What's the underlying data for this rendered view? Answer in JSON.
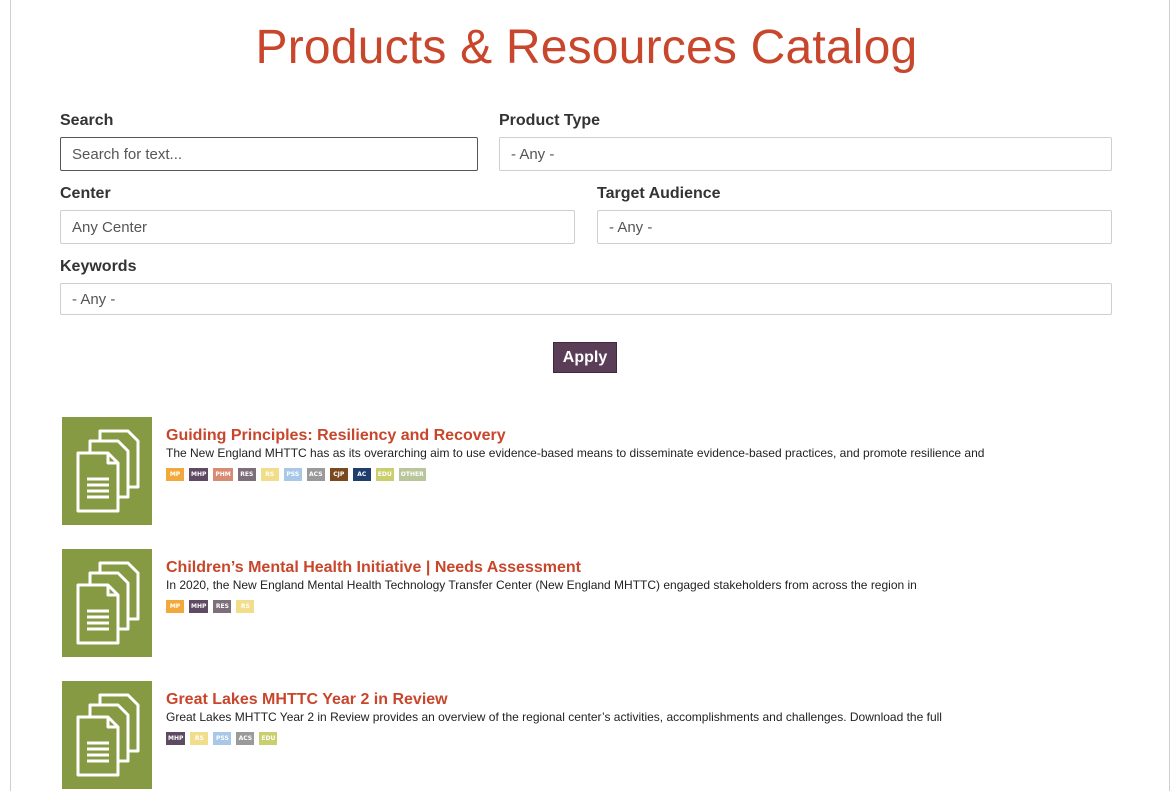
{
  "page": {
    "title": "Products & Resources Catalog"
  },
  "filters": {
    "search_label": "Search",
    "search_placeholder": "Search for text...",
    "product_type_label": "Product Type",
    "product_type_value": "- Any -",
    "center_label": "Center",
    "center_value": "Any Center",
    "target_audience_label": "Target Audience",
    "target_audience_value": "- Any -",
    "keywords_label": "Keywords",
    "keywords_value": "- Any -",
    "apply_label": "Apply"
  },
  "results": [
    {
      "title": "Guiding Principles: Resiliency and Recovery",
      "description": "The New England MHTTC has as its overarching aim to use evidence-based means to disseminate evidence-based practices, and promote resilience and",
      "icon": "document-stack-icon",
      "tags": [
        {
          "label": "MP",
          "color": "#f2a93b"
        },
        {
          "label": "MHP",
          "color": "#5e4a63"
        },
        {
          "label": "PHM",
          "color": "#d98a72"
        },
        {
          "label": "RES",
          "color": "#7d6e7c"
        },
        {
          "label": "RS",
          "color": "#f1dd8a"
        },
        {
          "label": "PSS",
          "color": "#a9c8e8"
        },
        {
          "label": "ACS",
          "color": "#9a9a9a"
        },
        {
          "label": "CJP",
          "color": "#7a4a1e"
        },
        {
          "label": "AC",
          "color": "#1f3e6d"
        },
        {
          "label": "EDU",
          "color": "#c9cf6d"
        },
        {
          "label": "OTHER",
          "color": "#b9c59a"
        }
      ]
    },
    {
      "title": "Children’s Mental Health Initiative | Needs Assessment",
      "description": "In 2020, the New England Mental Health Technology Transfer Center (New England MHTTC) engaged stakeholders from across the region in",
      "icon": "document-stack-icon",
      "tags": [
        {
          "label": "MP",
          "color": "#f2a93b"
        },
        {
          "label": "MHP",
          "color": "#5e4a63"
        },
        {
          "label": "RES",
          "color": "#7d6e7c"
        },
        {
          "label": "RS",
          "color": "#f1dd8a"
        }
      ]
    },
    {
      "title": "Great Lakes MHTTC Year 2 in Review",
      "description": "Great Lakes MHTTC Year 2 in Review provides an overview of the regional center’s activities, accomplishments and challenges. Download the full",
      "icon": "document-stack-icon",
      "tags": [
        {
          "label": "MHP",
          "color": "#5e4a63"
        },
        {
          "label": "RS",
          "color": "#f1dd8a"
        },
        {
          "label": "PSS",
          "color": "#a9c8e8"
        },
        {
          "label": "ACS",
          "color": "#9a9a9a"
        },
        {
          "label": "EDU",
          "color": "#c9cf6d"
        }
      ]
    }
  ]
}
